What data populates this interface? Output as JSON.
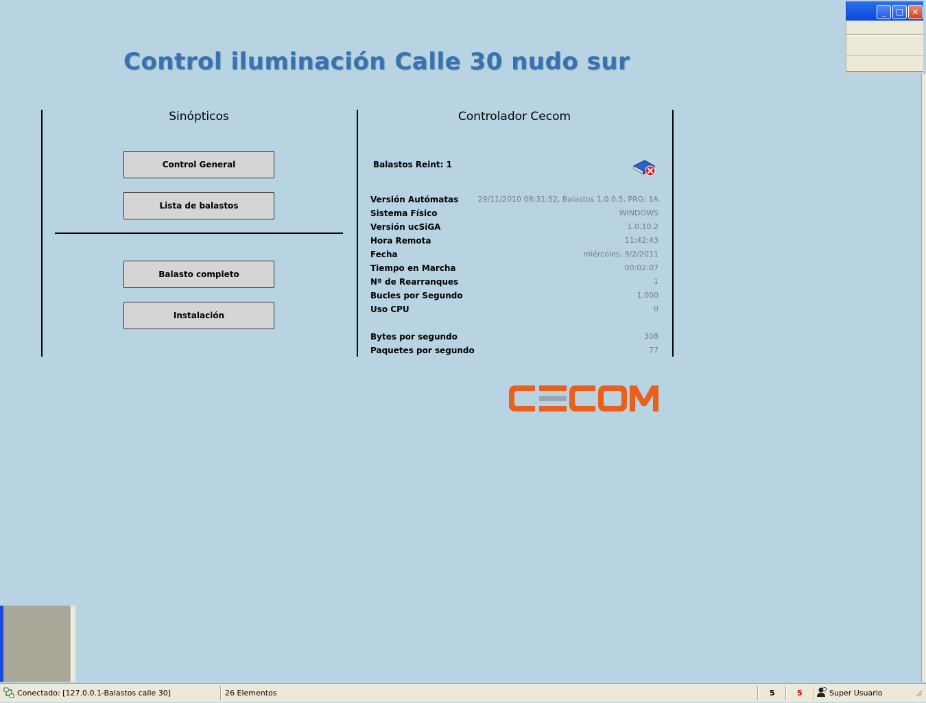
{
  "header": {
    "title": "Control iluminación Calle 30 nudo sur"
  },
  "window_controls": {
    "minimize": "_",
    "maximize": "□",
    "close": "×"
  },
  "sinopticos": {
    "heading": "Sinópticos",
    "buttons": [
      "Control General",
      "Lista de balastos",
      "Balasto completo",
      "Instalación"
    ]
  },
  "controlador": {
    "heading": "Controlador Cecom",
    "reint_label": "Balastos Reint: 1",
    "rows": [
      {
        "label": "Versión Autómatas",
        "value": "29/11/2010 08:31:52, Balastos 1.0.0.5, PRG: 1A"
      },
      {
        "label": "Sistema Físico",
        "value": "WINDOWS"
      },
      {
        "label": "Versión ucSiGA",
        "value": "1.0.10.2"
      },
      {
        "label": "Hora Remota",
        "value": "11:42:43"
      },
      {
        "label": "Fecha",
        "value": "miércoles, 9/2/2011"
      },
      {
        "label": "Tiempo en Marcha",
        "value": "00:02:07"
      },
      {
        "label": "Nº de Rearranques",
        "value": "1"
      },
      {
        "label": "Bucles por Segundo",
        "value": "1.000"
      },
      {
        "label": "Uso CPU",
        "value": "0"
      }
    ],
    "traffic_rows": [
      {
        "label": "Bytes por segundo",
        "value": "308"
      },
      {
        "label": "Paquetes por segundo",
        "value": "77"
      }
    ]
  },
  "logo": {
    "text": "CECOM",
    "color": "#e8601c"
  },
  "statusbar": {
    "connection": "Conectado: [127.0.0.1-Balastos calle 30]",
    "elements": "26 Elementos",
    "count_black": "5",
    "count_red": "5",
    "user": "Super Usuario"
  },
  "colors": {
    "background": "#b8d4e2",
    "title": "#3a72b0",
    "logo": "#e8601c",
    "alert_red": "#cc0000"
  }
}
